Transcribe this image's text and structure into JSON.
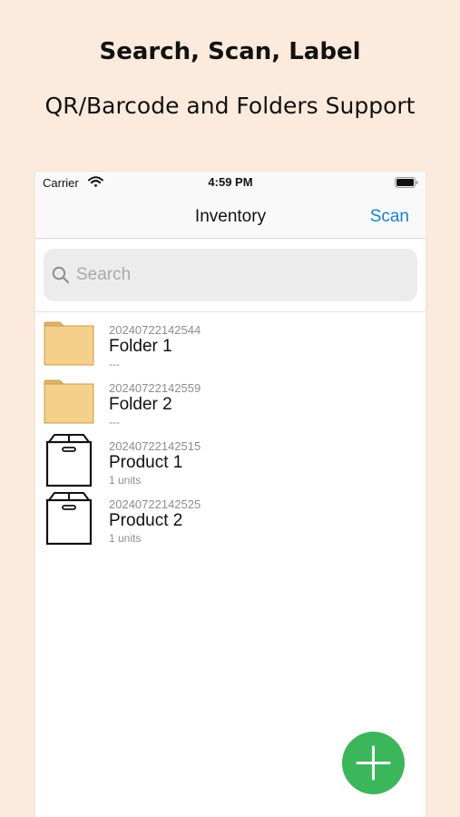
{
  "banner": {
    "headline": "Search, Scan, Label",
    "subheadline": "QR/Barcode and Folders Support"
  },
  "status_bar": {
    "carrier": "Carrier",
    "time": "4:59 PM",
    "icons": [
      "wifi-icon",
      "battery-icon"
    ]
  },
  "nav": {
    "title": "Inventory",
    "scan_label": "Scan",
    "accent_color": "#1a7fd6"
  },
  "search": {
    "value": "",
    "placeholder": "Search",
    "icon": "search-icon"
  },
  "items": [
    {
      "type": "folder",
      "icon": "folder-icon",
      "id": "20240722142544",
      "name": "Folder 1",
      "sub": "---"
    },
    {
      "type": "folder",
      "icon": "folder-icon",
      "id": "20240722142559",
      "name": "Folder 2",
      "sub": "---"
    },
    {
      "type": "product",
      "icon": "box-icon",
      "id": "20240722142515",
      "name": "Product 1",
      "sub": "1 units"
    },
    {
      "type": "product",
      "icon": "box-icon",
      "id": "20240722142525",
      "name": "Product 2",
      "sub": "1 units"
    }
  ],
  "fab": {
    "icon": "plus-icon",
    "color": "#3cb65a"
  }
}
